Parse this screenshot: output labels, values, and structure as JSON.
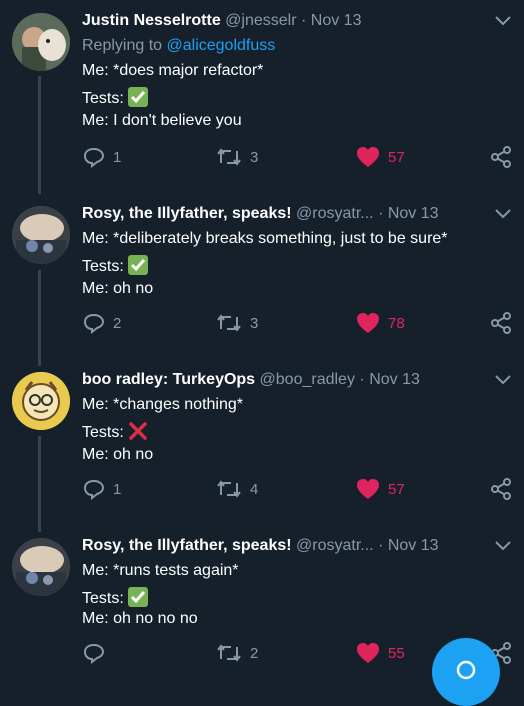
{
  "colors": {
    "background": "#15202b",
    "accent": "#1da1f2",
    "like": "#e0245e",
    "muted": "#8899a6"
  },
  "tweets": [
    {
      "name": "Justin Nesselrotte",
      "handle": "@jnesselr",
      "sep": "·",
      "date": "Nov 13",
      "reply_prefix": "Replying to",
      "reply_mention": "@alicegoldfuss",
      "line1": "Me: *does major refactor*",
      "line2": "Tests:",
      "line2_emoji": "check-mark-icon",
      "line3": "Me: I don't believe you",
      "replies": "1",
      "retweets": "3",
      "likes": "57"
    },
    {
      "name": "Rosy, the Illyfather, speaks!",
      "handle": "@rosyatr...",
      "sep": "·",
      "date": "Nov 13",
      "line1": "Me: *deliberately breaks something, just to be sure*",
      "line2": "Tests:",
      "line2_emoji": "check-mark-icon",
      "line3": "Me: oh no",
      "replies": "2",
      "retweets": "3",
      "likes": "78"
    },
    {
      "name": "boo radley: TurkeyOps",
      "handle": "@boo_radley",
      "sep": "·",
      "date": "Nov 13",
      "line1": "Me: *changes nothing*",
      "line2": "Tests:",
      "line2_emoji": "cross-mark-icon",
      "line3": "Me: oh no",
      "replies": "1",
      "retweets": "4",
      "likes": "57"
    },
    {
      "name": "Rosy, the Illyfather, speaks!",
      "handle": "@rosyatr...",
      "sep": "·",
      "date": "Nov 13",
      "line1": "Me: *runs tests again*",
      "line2": "Tests:",
      "line2_emoji": "check-mark-icon",
      "line3": "Me: oh no no no",
      "replies": "",
      "retweets": "2",
      "likes": "55"
    }
  ]
}
